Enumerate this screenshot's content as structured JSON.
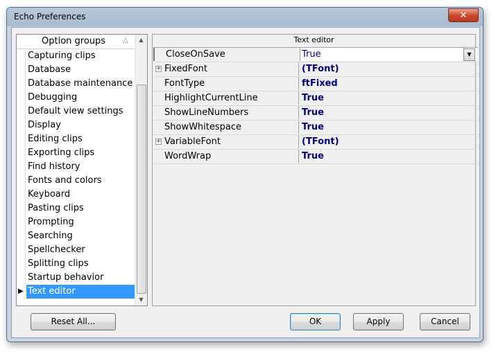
{
  "window": {
    "title": "Echo Preferences",
    "close_glyph": "✕"
  },
  "groups": {
    "header": "Option groups",
    "items": [
      "Capturing clips",
      "Database",
      "Database maintenance",
      "Debugging",
      "Default view settings",
      "Display",
      "Editing clips",
      "Exporting clips",
      "Find history",
      "Fonts and colors",
      "Keyboard",
      "Pasting clips",
      "Prompting",
      "Searching",
      "Spellchecker",
      "Splitting clips",
      "Startup behavior",
      "Text editor"
    ],
    "selected_index": 17
  },
  "editor": {
    "title": "Text editor",
    "rows": [
      {
        "name": "CloseOnSave",
        "value": "True",
        "expandable": false,
        "active": true
      },
      {
        "name": "FixedFont",
        "value": "(TFont)",
        "expandable": true
      },
      {
        "name": "FontType",
        "value": "ftFixed",
        "expandable": false
      },
      {
        "name": "HighlightCurrentLine",
        "value": "True",
        "expandable": false
      },
      {
        "name": "ShowLineNumbers",
        "value": "True",
        "expandable": false
      },
      {
        "name": "ShowWhitespace",
        "value": "True",
        "expandable": false
      },
      {
        "name": "VariableFont",
        "value": "(TFont)",
        "expandable": true
      },
      {
        "name": "WordWrap",
        "value": "True",
        "expandable": false
      }
    ]
  },
  "buttons": {
    "reset": "Reset All...",
    "ok": "OK",
    "apply": "Apply",
    "cancel": "Cancel"
  },
  "colors": {
    "selection": "#3399ff",
    "value_text": "#000080",
    "titlebar": "#b9c8da"
  }
}
